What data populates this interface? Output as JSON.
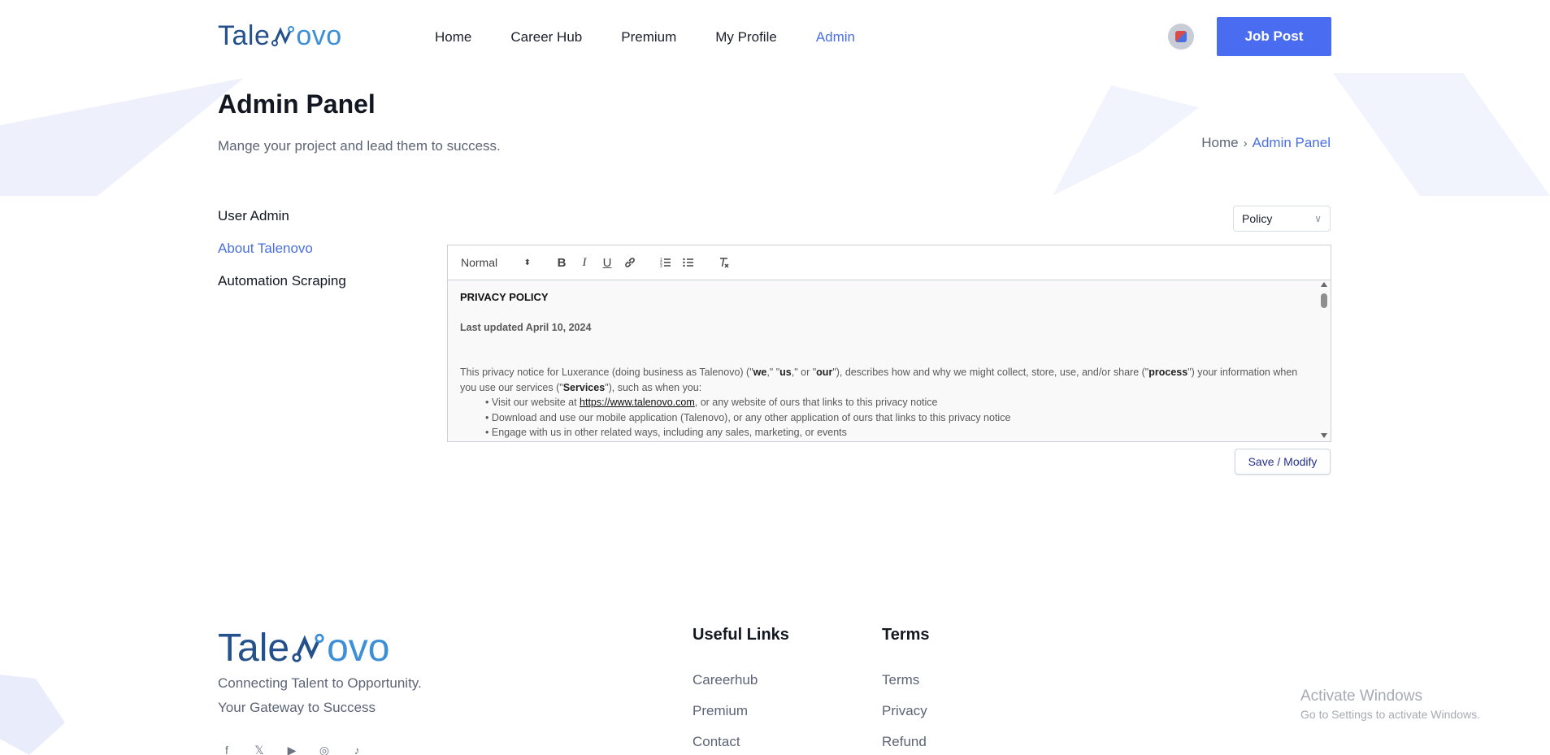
{
  "brand": {
    "logo_part1": "Tale",
    "logo_part2": "ovo",
    "accent": "#4a6cf0"
  },
  "nav": {
    "items": [
      "Home",
      "Career Hub",
      "Premium",
      "My Profile",
      "Admin"
    ],
    "active": "Admin"
  },
  "header": {
    "job_post_label": "Job Post"
  },
  "page": {
    "title": "Admin Panel",
    "subtitle": "Mange your project and lead them to success.",
    "breadcrumb": {
      "home": "Home",
      "current": "Admin Panel"
    }
  },
  "sidebar": {
    "items": [
      "User Admin",
      "About Talenovo",
      "Automation Scraping"
    ],
    "active": "About Talenovo"
  },
  "policy_select": {
    "value": "Policy"
  },
  "editor": {
    "toolbar": {
      "format": "Normal"
    },
    "heading": "PRIVACY POLICY",
    "updated": "Last updated April 10, 2024",
    "para1_a": "This privacy notice for Luxerance (doing business as Talenovo) (\"",
    "we": "we",
    "para1_b": ",\" \"",
    "us": "us",
    "para1_c": ",\" or \"",
    "our": "our",
    "para1_d": "\"), describes how and why we might collect, store, use, and/or share (\"",
    "process": "process",
    "para1_e": "\") your information when you use our services (\"",
    "services": "Services",
    "para1_f": "\"), such as when you:",
    "bullet1_a": "Visit our website at ",
    "bullet1_link": "https://www.talenovo.com",
    "bullet1_b": ", or any website of ours that links to this privacy notice",
    "bullet2": "Download and use our mobile application (Talenovo), or any other application of ours that links to this privacy notice",
    "bullet3": "Engage with us in other related ways, including any sales, marketing, or events"
  },
  "save_label": "Save / Modify",
  "footer": {
    "tagline1": "Connecting Talent to Opportunity.",
    "tagline2": "Your Gateway to Success",
    "useful_title": "Useful Links",
    "useful_links": [
      "Careerhub",
      "Premium",
      "Contact"
    ],
    "terms_title": "Terms",
    "terms_links": [
      "Terms",
      "Privacy",
      "Refund"
    ],
    "socials": [
      "facebook-icon",
      "x-icon",
      "youtube-icon",
      "instagram-icon",
      "tiktok-icon"
    ]
  },
  "watermark": {
    "line1": "Activate Windows",
    "line2": "Go to Settings to activate Windows."
  }
}
